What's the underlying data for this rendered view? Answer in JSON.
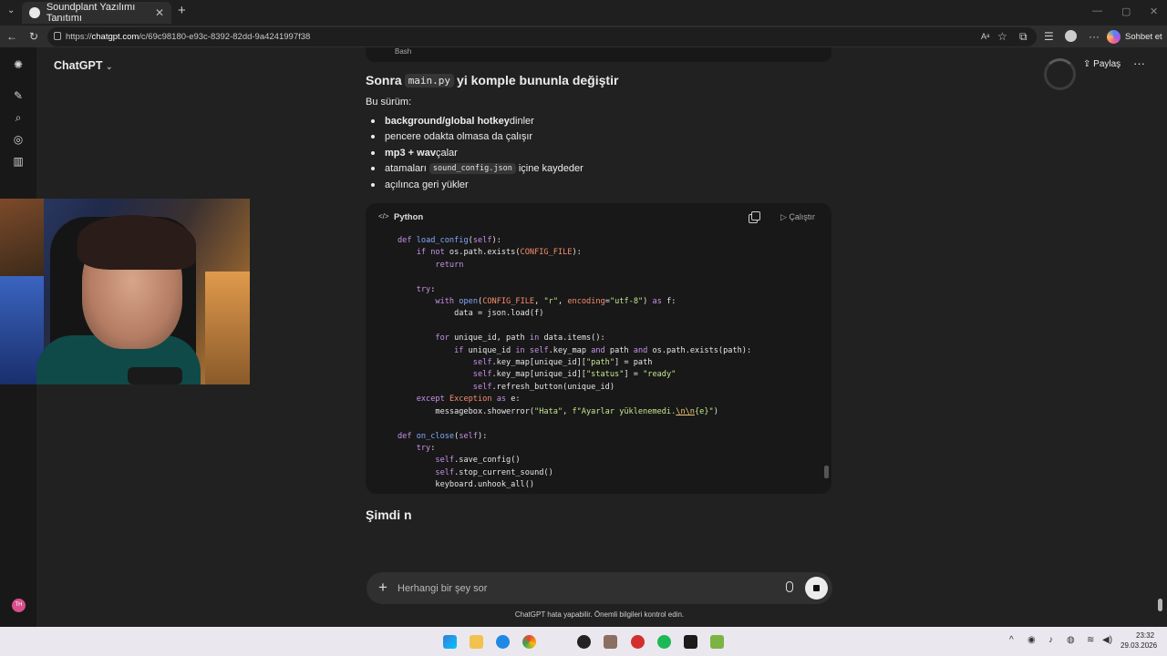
{
  "browser": {
    "tab_title": "Soundplant Yazılımı Tanıtımı",
    "url_prefix": "https://",
    "url_host": "chatgpt.com",
    "url_path": "/c/69c98180-e93c-8392-82dd-9a4241997f38",
    "copilot_label": "Sohbet et"
  },
  "app": {
    "model_label": "ChatGPT",
    "share_label": "Paylaş",
    "avatar_initials": "TH"
  },
  "message": {
    "prev_block_lang": "Bash",
    "heading_before": "Sonra",
    "heading_code": "main.py",
    "heading_after": "yi komple bununla değiştir",
    "intro": "Bu sürüm:",
    "bullets": [
      {
        "bold": "background/global hotkey",
        "text": " dinler"
      },
      {
        "bold": "",
        "text": "pencere odakta olmasa da çalışır"
      },
      {
        "bold": "mp3 + wav",
        "text": " çalar"
      },
      {
        "bold": "",
        "before": "atamaları",
        "code": "sound_config.json",
        "text": "içine kaydeder"
      },
      {
        "bold": "",
        "text": "açılınca geri yükler"
      }
    ],
    "code_lang": "Python",
    "run_label": "Çalıştır",
    "streaming_text": "Şimdi n"
  },
  "composer": {
    "placeholder": "Herhangi bir şey sor"
  },
  "disclaimer": "ChatGPT hata yapabilir. Önemli bilgileri kontrol edin.",
  "taskbar": {
    "time": "23:32",
    "date": "29.03.2026"
  },
  "colors": {
    "background": "#212121",
    "code_bg": "#181818",
    "accent_avatar": "#d84f8b"
  }
}
